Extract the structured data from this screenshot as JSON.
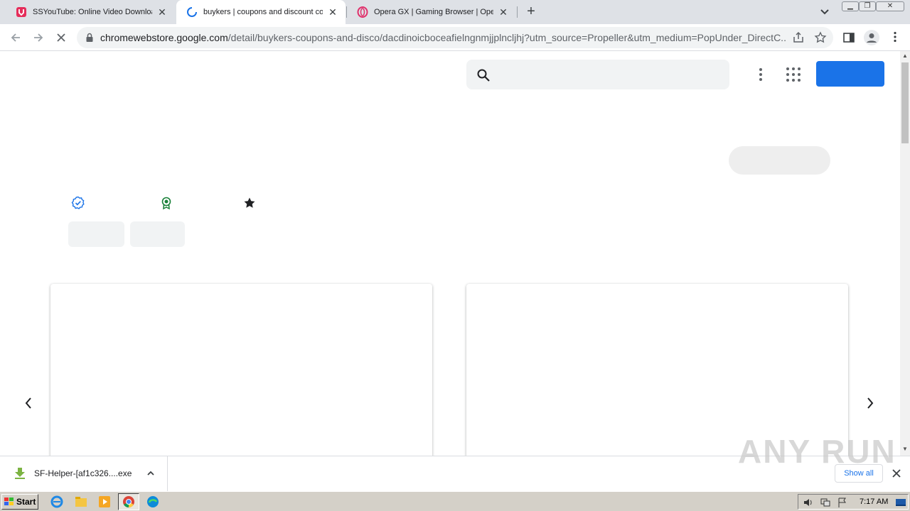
{
  "tabs": [
    {
      "title": "SSYouTube: Online Video Downloader",
      "favicon": "ssyoutube-icon",
      "active": false
    },
    {
      "title": "buykers | coupons and discount codes",
      "favicon": "loading-spinner-icon",
      "active": true
    },
    {
      "title": "Opera GX | Gaming Browser | Opera",
      "favicon": "opera-icon",
      "active": false
    }
  ],
  "address_bar": {
    "host": "chromewebstore.google.com",
    "path": "/detail/buykers-coupons-and-disco/dacdinoicboceafielngnmjjplncljhj?utm_source=Propeller&utm_medium=PopUnder_DirectC..."
  },
  "download_bar": {
    "file_name": "SF-Helper-[af1c326....exe",
    "show_all_label": "Show all"
  },
  "watermark": "ANY RUN",
  "taskbar": {
    "start_label": "Start",
    "clock": "7:17 AM"
  },
  "colors": {
    "accent": "#1a73e8",
    "verified": "#1a73e8",
    "featured": "#188038",
    "star": "#202124"
  }
}
